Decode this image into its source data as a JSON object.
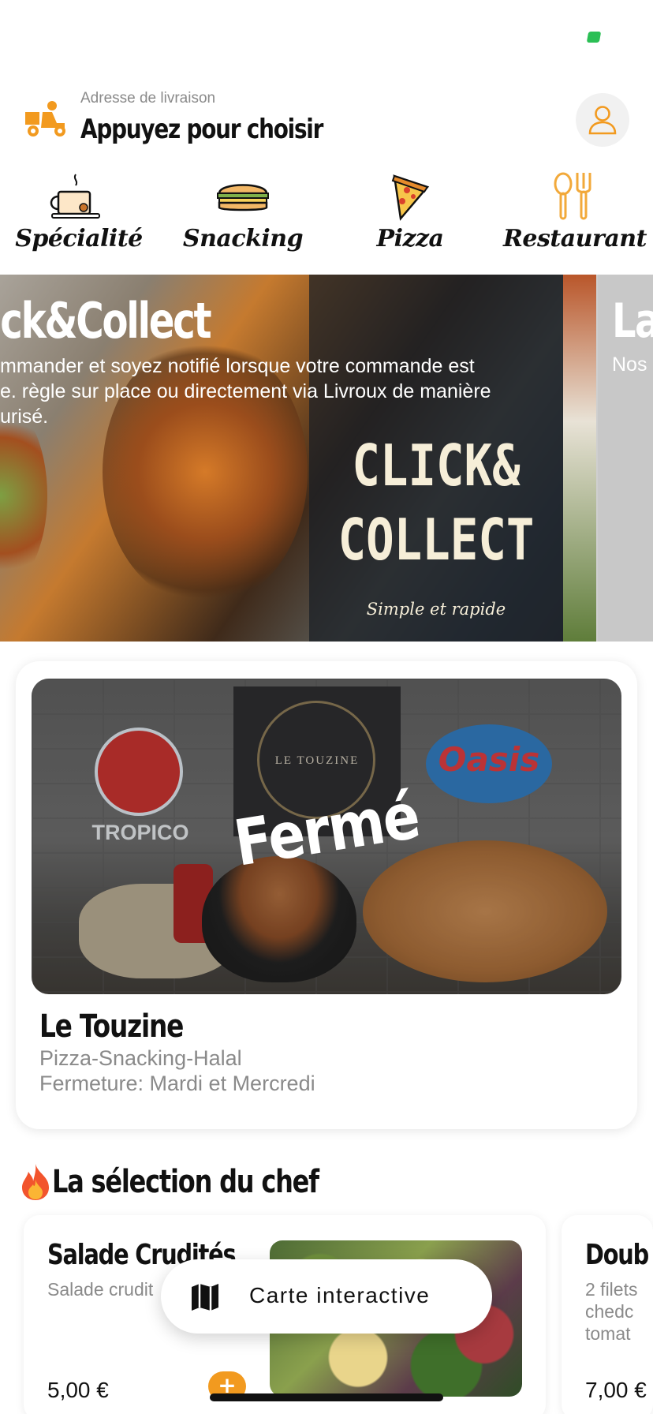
{
  "colors": {
    "accent": "#f29a1f",
    "status_green": "#2bbf55",
    "text_muted": "#8a8a8a"
  },
  "header": {
    "address_label": "Adresse de livraison",
    "address_value": "Appuyez pour choisir",
    "delivery_icon": "delivery-scooter-icon",
    "profile_icon": "user-icon"
  },
  "categories": [
    {
      "label": "Spécialité",
      "icon": "coffee-cup-icon"
    },
    {
      "label": "Snacking",
      "icon": "sandwich-icon"
    },
    {
      "label": "Pizza",
      "icon": "pizza-slice-icon"
    },
    {
      "label": "Restaurant",
      "icon": "cutlery-icon"
    }
  ],
  "banner": {
    "slide1": {
      "title": "ick&Collect",
      "description": "mmander et soyez notifié lorsque votre commande est\ne. règle sur place ou directement via Livroux de manière\nurisé.",
      "badge_title": "CLICK&\nCOLLECT",
      "badge_subtitle": "Simple et rapide"
    },
    "slide2": {
      "title": "La",
      "description": "Nos"
    }
  },
  "restaurant": {
    "name": "Le Touzine",
    "status": "Fermé",
    "tags": "Pizza-Snacking-Halal",
    "hours": "Fermeture: Mardi et Mercredi",
    "image_texts": {
      "logo": "LE TOUZINE",
      "brand1": "TROPICO",
      "brand2": "Oasis"
    }
  },
  "chef_selection": {
    "title": "La sélection du chef",
    "title_icon": "fire-icon",
    "dishes": [
      {
        "name": "Salade Crudités",
        "description": "Salade crudit",
        "price": "5,00 €",
        "add_label": "+"
      },
      {
        "name": "Doub",
        "description": "2 filets\nchedc\ntomat",
        "price": "7,00 €"
      }
    ]
  },
  "map_button": {
    "label": "Carte interactive",
    "icon": "map-icon"
  }
}
